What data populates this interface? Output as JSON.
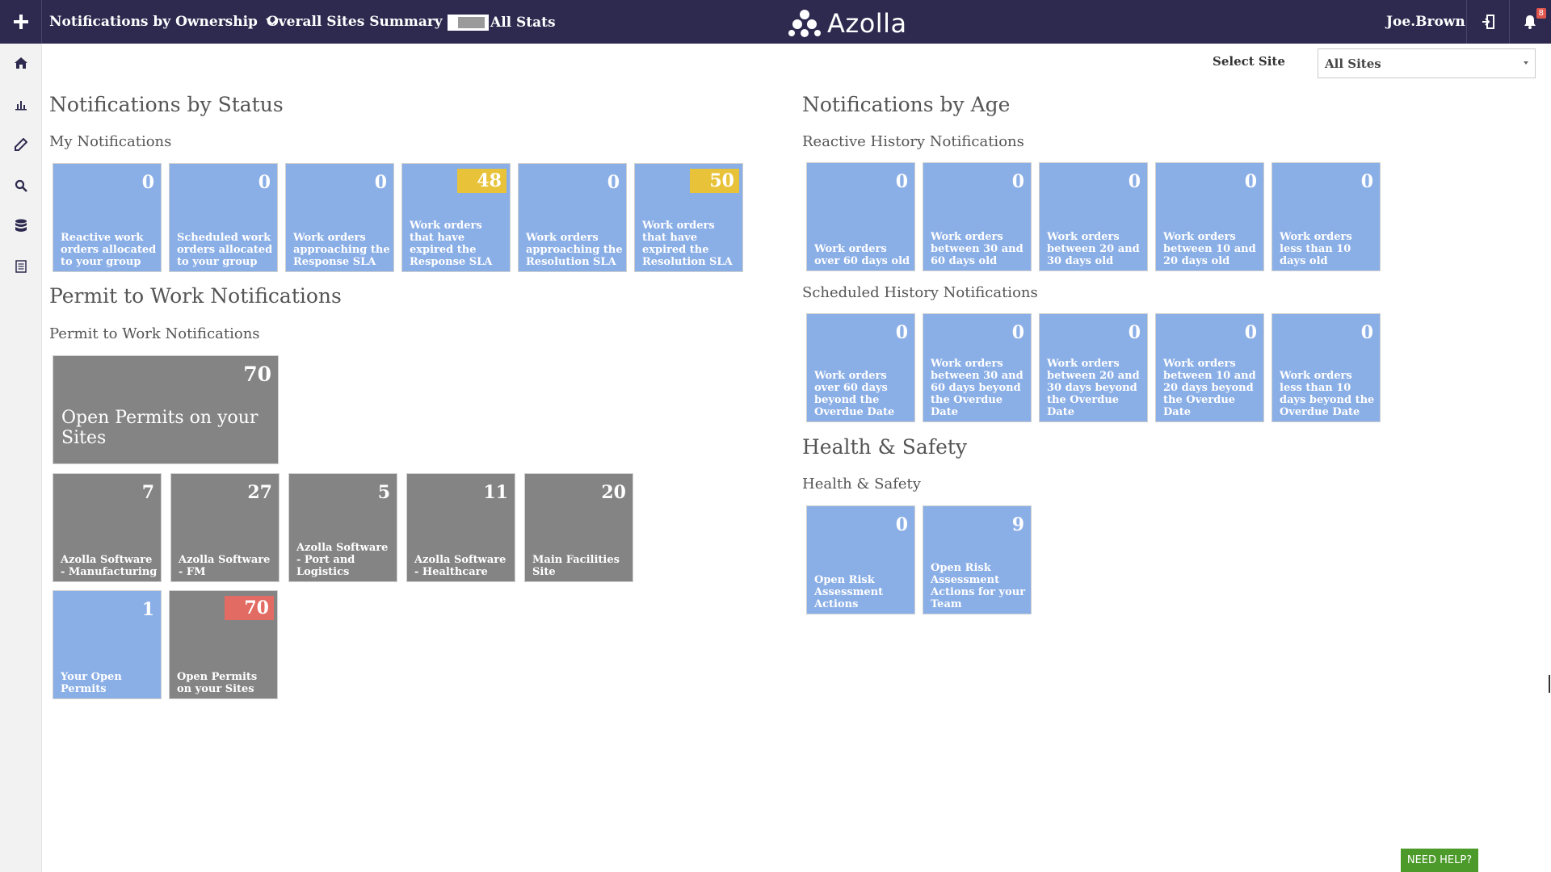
{
  "topbar": {
    "menu1": "Notifications by Ownership",
    "menu2": "Overall Sites Summary",
    "toggle_label": "All Stats",
    "logo": "Azolla",
    "user": "Joe.Brown",
    "notification_count": "8"
  },
  "site_select": {
    "label": "Select Site",
    "value": "All Sites"
  },
  "status": {
    "title": "Notifications by Status",
    "subtitle": "My Notifications",
    "tiles": [
      {
        "value": "0",
        "label": "Reactive work orders allocated to your group"
      },
      {
        "value": "0",
        "label": "Scheduled work orders allocated to your group"
      },
      {
        "value": "0",
        "label": "Work orders approaching the Response SLA"
      },
      {
        "value": "48",
        "label": "Work orders that have expired the Response SLA"
      },
      {
        "value": "0",
        "label": "Work orders approaching the Resolution SLA"
      },
      {
        "value": "50",
        "label": "Work orders that have expired the Resolution SLA"
      }
    ]
  },
  "permit": {
    "title": "Permit to Work Notifications",
    "subtitle": "Permit to Work Notifications",
    "big_tile": {
      "value": "70",
      "label": "Open Permits on your Sites"
    },
    "site_tiles": [
      {
        "value": "7",
        "label": "Azolla Software - Manufacturing"
      },
      {
        "value": "27",
        "label": "Azolla Software - FM"
      },
      {
        "value": "5",
        "label": "Azolla Software - Port and Logistics"
      },
      {
        "value": "11",
        "label": "Azolla Software - Healthcare"
      },
      {
        "value": "20",
        "label": "Main Facilities Site"
      }
    ],
    "bottom_tiles": [
      {
        "value": "1",
        "label": "Your Open Permits"
      },
      {
        "value": "70",
        "label": "Open Permits on your Sites"
      }
    ]
  },
  "age": {
    "title": "Notifications by Age",
    "reactive_subtitle": "Reactive History Notifications",
    "reactive_tiles": [
      {
        "value": "0",
        "label": "Work orders over 60 days old"
      },
      {
        "value": "0",
        "label": "Work orders between 30 and 60 days old"
      },
      {
        "value": "0",
        "label": "Work orders between 20 and 30 days old"
      },
      {
        "value": "0",
        "label": "Work orders between 10 and 20 days old"
      },
      {
        "value": "0",
        "label": "Work orders less than 10 days old"
      }
    ],
    "scheduled_subtitle": "Scheduled History Notifications",
    "scheduled_tiles": [
      {
        "value": "0",
        "label": "Work orders over 60 days beyond the Overdue Date"
      },
      {
        "value": "0",
        "label": "Work orders between 30 and 60 days beyond the Overdue Date"
      },
      {
        "value": "0",
        "label": "Work orders between 20 and 30 days beyond the Overdue Date"
      },
      {
        "value": "0",
        "label": "Work orders between 10 and 20 days beyond the Overdue Date"
      },
      {
        "value": "0",
        "label": "Work orders less than 10 days beyond the Overdue Date"
      }
    ]
  },
  "hs": {
    "title": "Health & Safety",
    "subtitle": "Health & Safety",
    "tiles": [
      {
        "value": "0",
        "label": "Open Risk Assessment Actions"
      },
      {
        "value": "9",
        "label": "Open Risk Assessment Actions for your Team"
      }
    ]
  },
  "help": {
    "label": "NEED HELP?"
  },
  "colors": {
    "topbar": "#2e2a4f",
    "tile_blue": "#8aaee6",
    "tile_grey": "#848484",
    "highlight_yellow": "#e8c33a",
    "highlight_red": "#e26b63",
    "help_green": "#4c9a2a"
  }
}
